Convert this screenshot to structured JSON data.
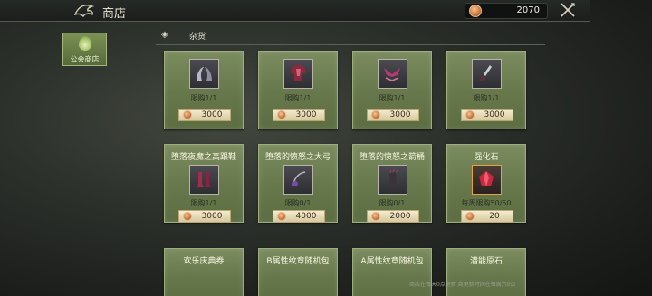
{
  "header": {
    "title": "商店",
    "back_icon": "dragon-emblem-icon",
    "currency_value": "2070",
    "currency_icon": "coin-icon",
    "close_icon": "crossed-swords-close-icon"
  },
  "sidebar": {
    "tabs": [
      {
        "label": "公会商店",
        "icon": "guild-leaf-icon",
        "active": true
      }
    ]
  },
  "category": {
    "label": "杂货",
    "icon": "tag-icon"
  },
  "items": [
    {
      "title": "",
      "limit": "限购1/1",
      "price": "3000",
      "icon": "horns-item-icon"
    },
    {
      "title": "",
      "limit": "限购1/1",
      "price": "3000",
      "icon": "armor-item-icon"
    },
    {
      "title": "",
      "limit": "限购1/1",
      "price": "3000",
      "icon": "wing-item-icon"
    },
    {
      "title": "",
      "limit": "限购1/1",
      "price": "3000",
      "icon": "dagger-item-icon"
    },
    {
      "title": "堕落夜魔之高跟鞋",
      "limit": "限购1/1",
      "price": "3000",
      "icon": "boots-item-icon"
    },
    {
      "title": "堕落的愤怒之大弓",
      "limit": "限购0/1",
      "price": "4000",
      "icon": "bow-item-icon"
    },
    {
      "title": "堕落的愤怒之箭桶",
      "limit": "限购0/1",
      "price": "2000",
      "icon": "quiver-item-icon"
    },
    {
      "title": "强化石",
      "limit": "每周限购50/50",
      "price": "20",
      "icon": "enhance-stone-icon"
    },
    {
      "title": "欢乐庆典券",
      "limit": "",
      "price": "",
      "icon": ""
    },
    {
      "title": "B属性纹章随机包",
      "limit": "",
      "price": "",
      "icon": ""
    },
    {
      "title": "A属性纹章随机包",
      "limit": "",
      "price": "",
      "icon": ""
    },
    {
      "title": "潜能原石",
      "limit": "",
      "price": "",
      "icon": ""
    }
  ],
  "footer": {
    "note": "商店在每天0点更新 商更新时间在每周六0点"
  },
  "colors": {
    "card_green": "#6f8150",
    "accent_gold": "#e2a23d",
    "price_bar": "#e8dcb6"
  }
}
